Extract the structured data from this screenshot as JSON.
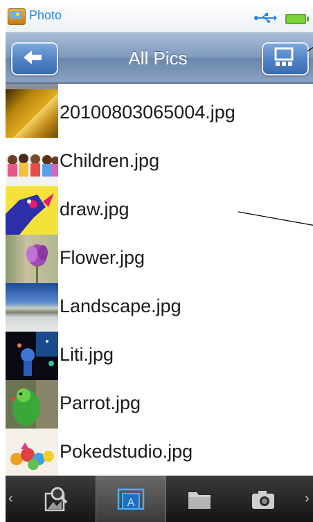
{
  "status_bar": {
    "app_title": "Photo",
    "icons": [
      "photo-app-icon",
      "usb-icon",
      "battery-icon"
    ]
  },
  "header": {
    "title": "All Pics",
    "back_icon": "arrow-left-icon",
    "view_icon": "thumbnail-view-icon"
  },
  "files": [
    {
      "name": "20100803065004.jpg"
    },
    {
      "name": "Children.jpg"
    },
    {
      "name": "draw.jpg"
    },
    {
      "name": "Flower.jpg"
    },
    {
      "name": "Landscape.jpg"
    },
    {
      "name": "Liti.jpg"
    },
    {
      "name": "Parrot.jpg"
    },
    {
      "name": "Pokedstudio.jpg"
    }
  ],
  "toolbar": {
    "left_arrow": "‹",
    "right_arrow": "›",
    "items": [
      {
        "icon": "search-pictures-icon"
      },
      {
        "icon": "albums-icon",
        "selected": true
      },
      {
        "icon": "folder-icon"
      },
      {
        "icon": "camera-icon"
      }
    ]
  }
}
